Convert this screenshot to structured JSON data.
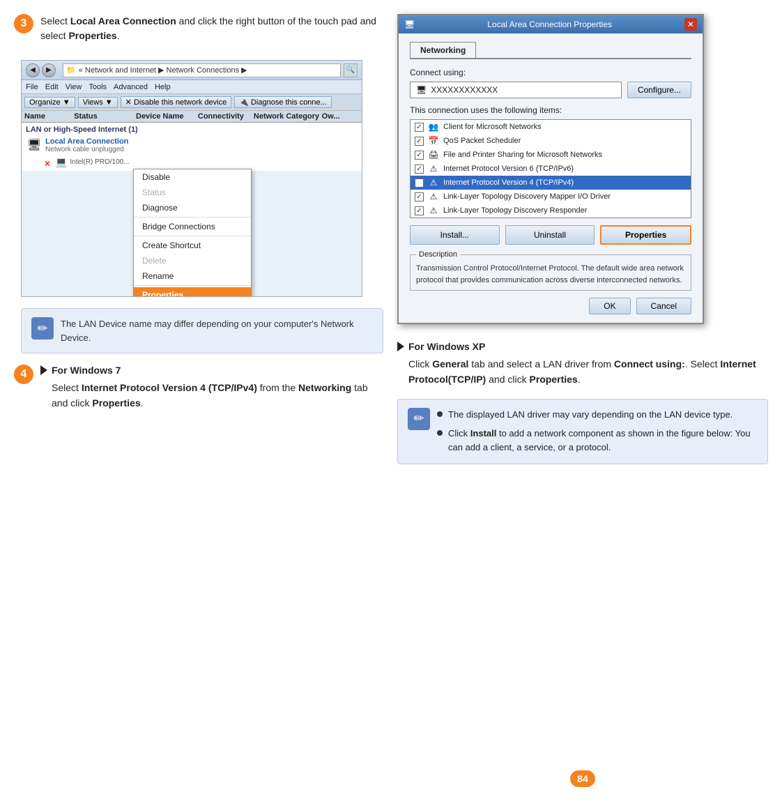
{
  "step3": {
    "number": "3",
    "text_before": "Select ",
    "bold1": "Local Area Connection",
    "text_middle": " and click the right button of the touch pad and select ",
    "bold2": "Properties",
    "text_end": ".",
    "screenshot": {
      "address": "« Network and Internet  ▶  Network Connections  ▶",
      "menu_items": [
        "File",
        "Edit",
        "View",
        "Tools",
        "Advanced",
        "Help"
      ],
      "action_bar": [
        "Organize ▼",
        "Views ▼",
        "Disable this network device",
        "Diagnose this connection"
      ],
      "table_headers": [
        "Name",
        "Status",
        "Device Name",
        "Connectivity",
        "Network Category",
        "Ow..."
      ],
      "group_label": "LAN or High-Speed Internet (1)",
      "connection_name": "Local Area Connection",
      "connection_status": "Network cable unplugged",
      "sub_device": "Intel(R) PRO/100...",
      "context_menu": {
        "items": [
          {
            "label": "Disable",
            "disabled": false,
            "highlighted": false
          },
          {
            "label": "Status",
            "disabled": true,
            "highlighted": false
          },
          {
            "label": "Diagnose",
            "disabled": false,
            "highlighted": false
          },
          {
            "label": "Bridge Connections",
            "disabled": false,
            "highlighted": false
          },
          {
            "label": "Create Shortcut",
            "disabled": false,
            "highlighted": false
          },
          {
            "label": "Delete",
            "disabled": true,
            "highlighted": false
          },
          {
            "label": "Rename",
            "disabled": false,
            "highlighted": false
          },
          {
            "label": "Properties",
            "disabled": false,
            "highlighted": true
          }
        ]
      }
    },
    "note": {
      "text": "The LAN Device name may differ depending on your computer's Network Device."
    }
  },
  "step4": {
    "number": "4",
    "substep_win7": {
      "title": "For Windows 7",
      "body_before": "Select ",
      "bold1": "Internet Protocol Version 4 (TCP/IPv4)",
      "body_middle": " from the ",
      "bold2": "Networking",
      "body_end": " tab and click ",
      "bold3": "Properties",
      "body_final": "."
    },
    "substep_winxp": {
      "title": "For Windows XP",
      "body_before": "Click ",
      "bold1": "General",
      "body_middle1": " tab and select a LAN driver from ",
      "bold2": "Connect using:",
      "body_middle2": ". Select ",
      "bold3": "Internet Protocol(TCP/IP)",
      "body_middle3": " and click ",
      "bold4": "Properties",
      "body_end": "."
    },
    "note_bullets": [
      "The displayed LAN driver may vary depending on the LAN device type.",
      "Click Install to add a network component as shown in the figure below: You can add a client, a service, or a protocol."
    ]
  },
  "dialog": {
    "title": "Local Area Connection Properties",
    "tab": "Networking",
    "connect_using_label": "Connect using:",
    "connect_using_value": "XXXXXXXXXXXX",
    "configure_btn": "Configure...",
    "items_label": "This connection uses the following items:",
    "items": [
      {
        "checked": true,
        "label": "Client for Microsoft Networks",
        "highlighted": false
      },
      {
        "checked": true,
        "label": "QoS Packet Scheduler",
        "highlighted": false
      },
      {
        "checked": true,
        "label": "File and Printer Sharing for Microsoft Networks",
        "highlighted": false
      },
      {
        "checked": true,
        "label": "Internet Protocol Version 6 (TCP/IPv6)",
        "highlighted": false
      },
      {
        "checked": true,
        "label": "Internet Protocol Version 4 (TCP/IPv4)",
        "highlighted": true
      },
      {
        "checked": true,
        "label": "Link-Layer Topology Discovery Mapper I/O Driver",
        "highlighted": false
      },
      {
        "checked": true,
        "label": "Link-Layer Topology Discovery Responder",
        "highlighted": false
      }
    ],
    "btn_install": "Install...",
    "btn_uninstall": "Uninstall",
    "btn_properties": "Properties",
    "description_label": "Description",
    "description_text": "Transmission Control Protocol/Internet Protocol. The default wide area network protocol that provides communication across diverse interconnected networks.",
    "btn_ok": "OK",
    "btn_cancel": "Cancel"
  },
  "page_number": "84"
}
